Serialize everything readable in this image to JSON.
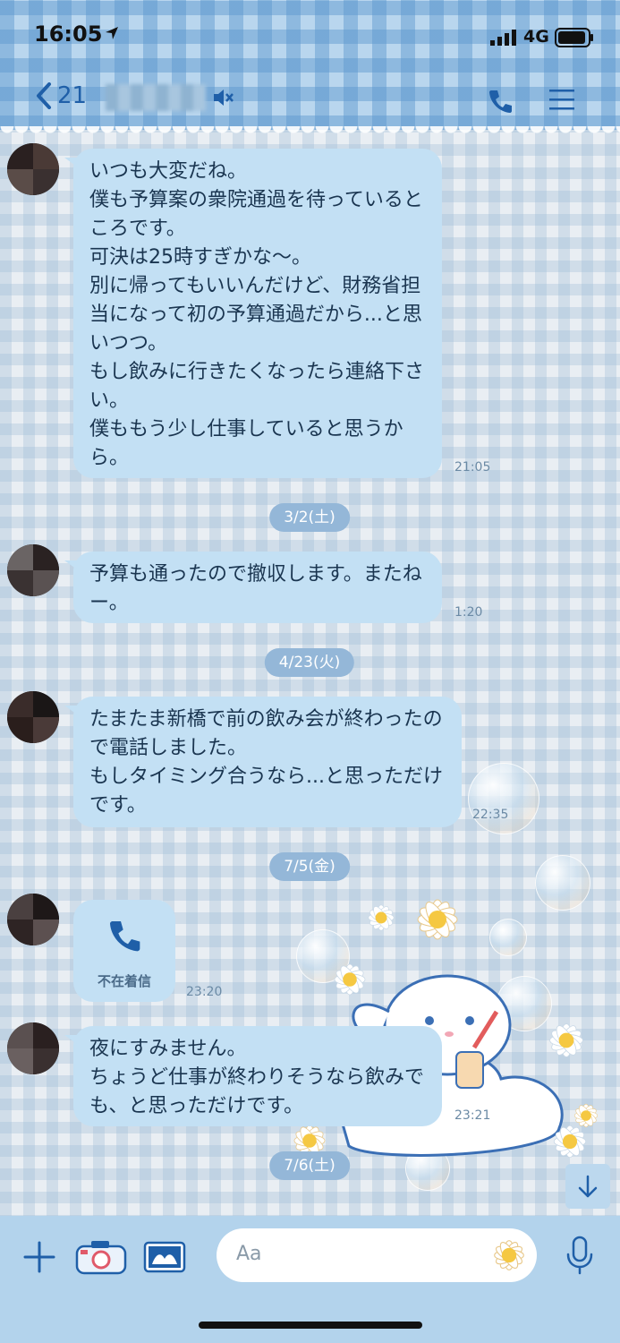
{
  "status": {
    "time": "16:05",
    "network": "4G"
  },
  "header": {
    "back_count": "21"
  },
  "messages": [
    {
      "text": "いつも大変だね。\n僕も予算案の衆院通過を待っているところです。\n可決は25時すぎかな〜。\n別に帰ってもいいんだけど、財務省担当になって初の予算通過だから...と思いつつ。\nもし飲みに行きたくなったら連絡下さい。\n僕ももう少し仕事していると思うから。",
      "time": "21:05"
    },
    {
      "text": "予算も通ったので撤収します。またねー。",
      "time": "1:20"
    },
    {
      "text": "たまたま新橋で前の飲み会が終わったので電話しました。\nもしタイミング合うなら...と思っただけです。",
      "time": "22:35"
    },
    {
      "call_label": "不在着信",
      "time": "23:20"
    },
    {
      "text": "夜にすみません。\nちょうど仕事が終わりそうなら飲みでも、と思っただけです。",
      "time": "23:21"
    }
  ],
  "dates": [
    "3/2(土)",
    "4/23(火)",
    "7/5(金)",
    "7/6(土)"
  ],
  "input": {
    "placeholder": "Aa"
  },
  "colors": {
    "bubble": "#c3e0f4",
    "accent": "#1f5fa8",
    "date_pill": "#94b7d8"
  },
  "icons": [
    "location-arrow-icon",
    "signal-icon",
    "battery-icon",
    "back-chevron-icon",
    "mute-icon",
    "phone-icon",
    "menu-icon",
    "phone-call-icon",
    "plus-icon",
    "camera-icon",
    "image-icon",
    "emoji-icon",
    "mic-icon",
    "arrow-down-icon"
  ]
}
